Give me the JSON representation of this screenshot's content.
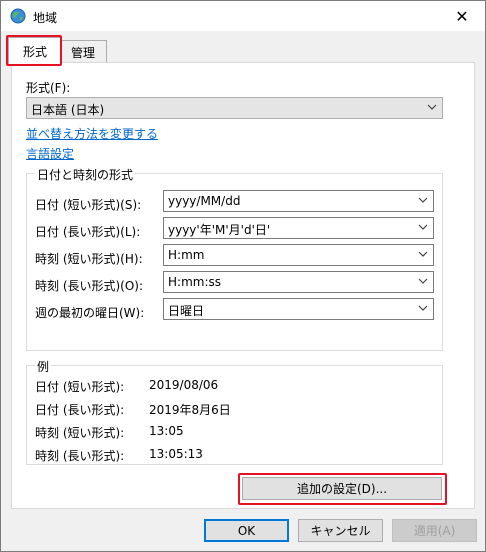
{
  "window": {
    "title": "地域"
  },
  "tabs": [
    {
      "label": "形式"
    },
    {
      "label": "管理"
    }
  ],
  "format": {
    "label": "形式(F):",
    "selected": "日本語 (日本)",
    "sort_link": "並べ替え方法を変更する",
    "language_link": "言語設定"
  },
  "datetime_group": {
    "title": "日付と時刻の形式",
    "rows": [
      {
        "label": "日付 (短い形式)(S):",
        "value": "yyyy/MM/dd"
      },
      {
        "label": "日付 (長い形式)(L):",
        "value": "yyyy'年'M'月'd'日'"
      },
      {
        "label": "時刻 (短い形式)(H):",
        "value": "H:mm"
      },
      {
        "label": "時刻 (長い形式)(O):",
        "value": "H:mm:ss"
      },
      {
        "label": "週の最初の曜日(W):",
        "value": "日曜日"
      }
    ]
  },
  "examples": {
    "title": "例",
    "rows": [
      {
        "label": "日付 (短い形式):",
        "value": "2019/08/06"
      },
      {
        "label": "日付 (長い形式):",
        "value": "2019年8月6日"
      },
      {
        "label": "時刻 (短い形式):",
        "value": "13:05"
      },
      {
        "label": "時刻 (長い形式):",
        "value": "13:05:13"
      }
    ]
  },
  "buttons": {
    "additional": "追加の設定(D)...",
    "ok": "OK",
    "cancel": "キャンセル",
    "apply": "適用(A)"
  },
  "colors": {
    "highlight": "#e81123",
    "link": "#0066cc",
    "accent": "#0078d7"
  },
  "icons": [
    "globe-icon",
    "close-icon",
    "chevron-down-icon"
  ]
}
